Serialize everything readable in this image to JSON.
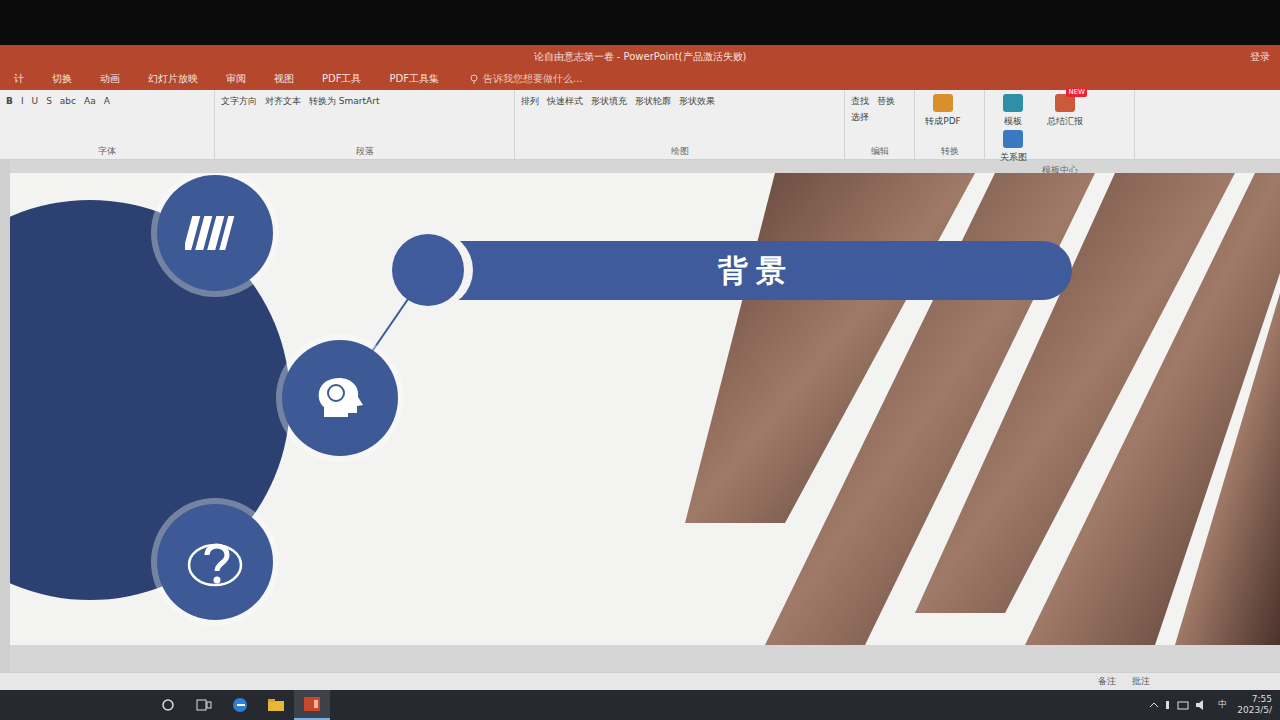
{
  "window": {
    "title": "论自由意志第一卷 - PowerPoint(产品激活失败)",
    "login": "登录"
  },
  "menu_tabs": [
    {
      "label": "计",
      "selected": false
    },
    {
      "label": "切换",
      "selected": false
    },
    {
      "label": "动画",
      "selected": false
    },
    {
      "label": "幻灯片放映",
      "selected": false
    },
    {
      "label": "审阅",
      "selected": false
    },
    {
      "label": "视图",
      "selected": false
    },
    {
      "label": "PDF工具",
      "selected": false
    },
    {
      "label": "PDF工具集",
      "selected": false
    }
  ],
  "tell_me": "告诉我您想要做什么...",
  "ribbon": {
    "groups": [
      {
        "label": "字体",
        "items": [
          {
            "label": "B"
          },
          {
            "label": "I"
          },
          {
            "label": "U"
          },
          {
            "label": "S"
          },
          {
            "label": "abc"
          },
          {
            "label": "Aa"
          },
          {
            "label": "A"
          }
        ]
      },
      {
        "label": "段落",
        "items": [
          {
            "label": "文字方向"
          },
          {
            "label": "对齐文本"
          },
          {
            "label": "转换为 SmartArt"
          }
        ]
      },
      {
        "label": "绘图",
        "items": [
          {
            "label": "排列"
          },
          {
            "label": "快速样式"
          },
          {
            "label": "形状填充"
          },
          {
            "label": "形状轮廓"
          },
          {
            "label": "形状效果"
          }
        ]
      },
      {
        "label": "编辑",
        "items": [
          {
            "label": "查找"
          },
          {
            "label": "替换"
          },
          {
            "label": "选择"
          }
        ]
      },
      {
        "label": "转换",
        "items": [
          {
            "label": "转成PDF"
          }
        ]
      },
      {
        "label": "模板中心",
        "items": [
          {
            "label": "模板"
          },
          {
            "label": "总结汇报",
            "badge": "NEW"
          },
          {
            "label": "关系图"
          }
        ]
      }
    ]
  },
  "slide": {
    "title": "背景"
  },
  "status_bar": {
    "items": [
      "备注",
      "批注"
    ]
  },
  "taskbar": {
    "time": "7:55",
    "date": "2023/5/",
    "ime": "中"
  }
}
